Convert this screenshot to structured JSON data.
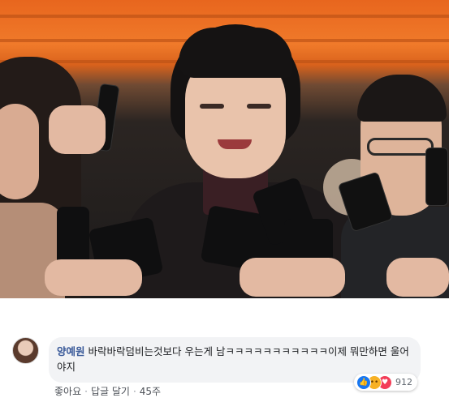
{
  "photo": {
    "icons": [
      "press-photo"
    ]
  },
  "comment": {
    "author": "양예원",
    "text": "바락바락덤비는것보다 우는게 남ㅋㅋㅋㅋㅋㅋㅋㅋㅋㅋㅋ이제 뭐만하면 울어야지",
    "reaction_count": "912",
    "reaction_icons": [
      "like-icon",
      "haha-icon",
      "love-icon"
    ],
    "actions": {
      "like_label": "좋아요",
      "separator": "·",
      "reply_label": "답글 달기",
      "timestamp": "45주"
    }
  },
  "colors": {
    "author_link": "#385898",
    "bubble_bg": "#f2f3f5",
    "like_blue": "#1877f2",
    "haha_yellow": "#f7b125",
    "love_red": "#f33e58"
  }
}
